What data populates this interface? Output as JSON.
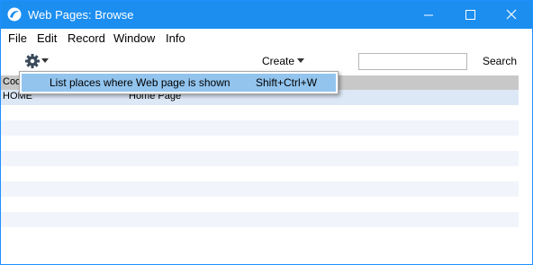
{
  "window": {
    "title": "Web Pages: Browse",
    "titlebar_color": "#1c8ef0"
  },
  "menubar": {
    "items": [
      "File",
      "Edit",
      "Record",
      "Window",
      "Info"
    ]
  },
  "toolbar": {
    "create_label": "Create",
    "search_label": "Search",
    "search_value": ""
  },
  "list": {
    "header": {
      "col1": "Coc"
    },
    "rows": [
      {
        "code": "HOME",
        "name": "Home Page"
      }
    ]
  },
  "context_menu": {
    "item_label": "List places where Web page is shown",
    "item_shortcut": "Shift+Ctrl+W",
    "highlight_color": "#92c4ee"
  }
}
